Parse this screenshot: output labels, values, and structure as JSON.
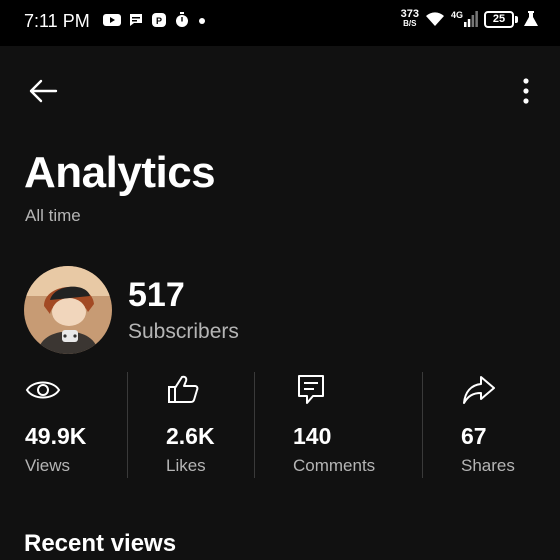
{
  "status_bar": {
    "time": "7:11 PM",
    "net_speed_value": "373",
    "net_speed_unit": "B/S",
    "network_type": "4G",
    "battery_level": "25",
    "left_icons": [
      "youtube-icon",
      "chat-bubble-icon",
      "paytm-icon",
      "timer-icon",
      "notification-dot-icon"
    ],
    "right_icons": [
      "wifi-icon",
      "cell-signal-icon",
      "battery-icon",
      "flask-icon"
    ]
  },
  "header": {
    "back_icon": "arrow-left-icon",
    "menu_icon": "more-vertical-icon"
  },
  "page": {
    "title": "Analytics",
    "subtitle": "All time"
  },
  "channel": {
    "subscriber_count": "517",
    "subscriber_label": "Subscribers"
  },
  "stats": [
    {
      "icon": "eye-icon",
      "value": "49.9K",
      "label": "Views"
    },
    {
      "icon": "thumbs-up-icon",
      "value": "2.6K",
      "label": "Likes"
    },
    {
      "icon": "comment-icon",
      "value": "140",
      "label": "Comments"
    },
    {
      "icon": "share-icon",
      "value": "67",
      "label": "Shares"
    }
  ],
  "sections": {
    "recent_views_title": "Recent views"
  },
  "colors": {
    "background": "#111111",
    "status_bar": "#000000",
    "text_primary": "#ffffff",
    "text_secondary": "#b5b5b5",
    "divider": "#3a3a3a"
  }
}
